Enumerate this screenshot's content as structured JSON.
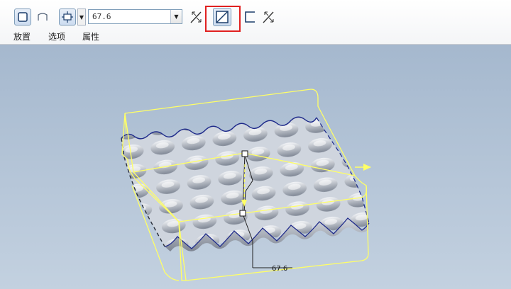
{
  "toolbar": {
    "depth_value": "67.6",
    "tabs": [
      {
        "label": "放置"
      },
      {
        "label": "选项"
      },
      {
        "label": "属性"
      }
    ],
    "icons": [
      "solid-icon",
      "surface-icon",
      "depth-option-icon",
      "flip-direction-icon",
      "remove-material-icon",
      "thicken-icon",
      "flip-thicken-icon"
    ],
    "highlight_color": "#e02020"
  },
  "viewport": {
    "dimension_label": "67.6",
    "background": "#b4c5d8",
    "preview_color": "#ffff66"
  }
}
